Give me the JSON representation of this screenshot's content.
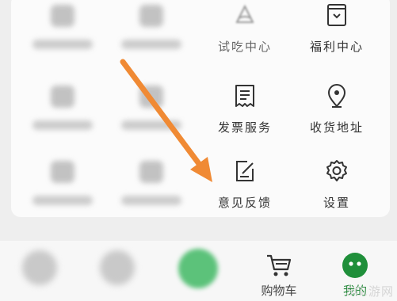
{
  "menu": {
    "items": [
      {
        "label": "试吃中心",
        "icon": "cake-slice-icon"
      },
      {
        "label": "福利中心",
        "icon": "gift-tag-icon"
      },
      {
        "label": "发票服务",
        "icon": "receipt-icon"
      },
      {
        "label": "收货地址",
        "icon": "location-pin-icon"
      },
      {
        "label": "意见反馈",
        "icon": "feedback-edit-icon"
      },
      {
        "label": "设置",
        "icon": "gear-icon"
      }
    ]
  },
  "tabbar": {
    "items": [
      {
        "label": "",
        "icon": "home-avatar-icon"
      },
      {
        "label": "",
        "icon": "category-avatar-icon"
      },
      {
        "label": "",
        "icon": "green-center-icon"
      },
      {
        "label": "购物车",
        "icon": "cart-icon"
      },
      {
        "label": "我的",
        "icon": "profile-face-icon"
      }
    ],
    "active": "我的"
  },
  "colors": {
    "accent": "#2a8a3e",
    "arrow": "#f08a34"
  },
  "watermark": {
    "text": "5G.游网"
  }
}
